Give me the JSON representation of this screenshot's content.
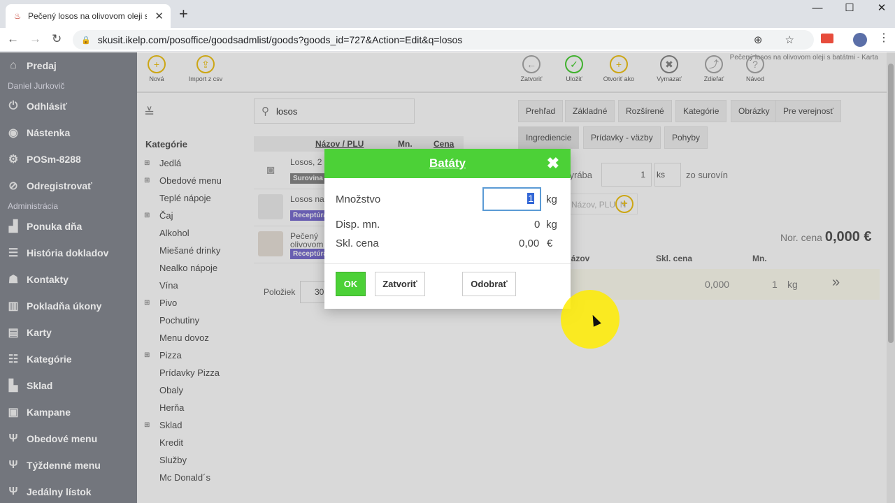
{
  "browser": {
    "tab_title": "Pečený losos na olivovom oleji s batátmi",
    "url": "skusit.ikelp.com/posoffice/goodsadmlist/goods?goods_id=727&Action=Edit&q=losos",
    "new_tab": "+",
    "tab_close": "✕",
    "minimize": "—",
    "maximize": "☐",
    "close": "✕",
    "back": "←",
    "forward": "→",
    "reload": "↻",
    "lock": "🔒",
    "url_icons": "⊕ ☆",
    "menu_dots": "⋮"
  },
  "sidebar": {
    "items": [
      {
        "icon": "⌂",
        "label": "Predaj"
      },
      {
        "sub": "Daniel Jurkovič"
      },
      {
        "icon": "⏻",
        "label": "Odhlásiť"
      },
      {
        "icon": "◉",
        "label": "Nástenka"
      },
      {
        "icon": "⚙",
        "label": "POSm-8288"
      },
      {
        "icon": "⊘",
        "label": "Odregistrovať"
      },
      {
        "sub": "Administrácia"
      },
      {
        "icon": "▟",
        "label": "Ponuka dňa"
      },
      {
        "icon": "☰",
        "label": "História dokladov"
      },
      {
        "icon": "☗",
        "label": "Kontakty"
      },
      {
        "icon": "▥",
        "label": "Pokladňa úkony"
      },
      {
        "icon": "▤",
        "label": "Karty"
      },
      {
        "icon": "☷",
        "label": "Kategórie"
      },
      {
        "icon": "▙",
        "label": "Sklad"
      },
      {
        "icon": "▣",
        "label": "Kampane"
      },
      {
        "icon": "Ψ",
        "label": "Obedové menu"
      },
      {
        "icon": "Ψ",
        "label": "Týždenné menu"
      },
      {
        "icon": "Ψ",
        "label": "Jedálny lístok"
      }
    ]
  },
  "toolbar": {
    "left": [
      {
        "icon": "+",
        "label": "Nová"
      },
      {
        "icon": "⇪",
        "label": "Import z csv"
      }
    ],
    "right": [
      {
        "icon": "←",
        "label": "Zatvoriť"
      },
      {
        "icon": "✓",
        "label": "Uložiť"
      },
      {
        "icon": "+",
        "label": "Otvoriť ako"
      },
      {
        "icon": "✖",
        "label": "Vymazať"
      },
      {
        "icon": "⤴",
        "label": "Zdieľať"
      },
      {
        "icon": "?",
        "label": "Návod"
      }
    ],
    "breadcrumb": "Pečený losos na olivovom oleji s batátmi - Karta"
  },
  "search": {
    "value": "losos",
    "icon": "⚲"
  },
  "collapse": "≚",
  "categories": {
    "title": "Kategórie",
    "items": [
      {
        "plus": "⊞",
        "label": "Jedlá"
      },
      {
        "plus": "⊞",
        "label": "Obedové menu"
      },
      {
        "plus": "",
        "label": "Teplé nápoje"
      },
      {
        "plus": "⊞",
        "label": "Čaj"
      },
      {
        "plus": "",
        "label": "Alkohol"
      },
      {
        "plus": "",
        "label": "Miešané drinky"
      },
      {
        "plus": "",
        "label": "Nealko nápoje"
      },
      {
        "plus": "",
        "label": "Vína"
      },
      {
        "plus": "⊞",
        "label": "Pivo"
      },
      {
        "plus": "",
        "label": "Pochutiny"
      },
      {
        "plus": "",
        "label": "Menu dovoz"
      },
      {
        "plus": "⊞",
        "label": "Pizza"
      },
      {
        "plus": "",
        "label": "Prídavky Pizza"
      },
      {
        "plus": "",
        "label": "Obaly"
      },
      {
        "plus": "",
        "label": "Herňa"
      },
      {
        "plus": "⊞",
        "label": "Sklad"
      },
      {
        "plus": "",
        "label": "Kredit"
      },
      {
        "plus": "",
        "label": "Služby"
      },
      {
        "plus": "",
        "label": "Mc Donald´s"
      }
    ]
  },
  "product_list": {
    "headers": {
      "name": "Názov / PLU",
      "qty": "Mn.",
      "price": "Cena"
    },
    "rows": [
      {
        "name": "Losos, 2",
        "tag": "Surovina",
        "tag_color": "#888888"
      },
      {
        "name": "Losos na",
        "tag": "Receptúra",
        "tag_color": "#7b6fd0"
      },
      {
        "name": "Pečený",
        "name2": "olivovom",
        "tag": "Receptúra",
        "tag_color": "#7b6fd0"
      }
    ],
    "pager_label": "Položiek",
    "pager_value": "30"
  },
  "detail_tabs": {
    "row1": [
      "Prehľad",
      "Základné",
      "Rozšírené",
      "Kategórie",
      "Obrázky",
      "Pre verejnosť"
    ],
    "row2": [
      "Ingrediencie",
      "Prídavky - väzby",
      "Pohyby"
    ]
  },
  "recipe": {
    "vyraba": "vyrába",
    "qty": "1",
    "unit": "ks",
    "z_surovin": "zo surovín",
    "add_placeholder": "Názov, PLU, N",
    "add_icon": "+",
    "nor_cena_label": "Nor. cena",
    "nor_cena_value": "0,000 €",
    "headers": {
      "name": "Názov",
      "skl_cena": "Skl. cena",
      "mn": "Mn."
    },
    "row": {
      "skl_cena": "0,000",
      "mn": "1",
      "unit": "kg",
      "arrow": "»"
    }
  },
  "modal": {
    "title": "Batáty",
    "close": "✖",
    "mnozstvo_label": "Množstvo",
    "mnozstvo_value": "1",
    "mnozstvo_unit": "kg",
    "disp_label": "Disp. mn.",
    "disp_value": "0",
    "disp_unit": "kg",
    "skl_label": "Skl. cena",
    "skl_value": "0,00",
    "skl_unit": "€",
    "ok": "OK",
    "zatvorit": "Zatvoriť",
    "odobrat": "Odobrať"
  }
}
